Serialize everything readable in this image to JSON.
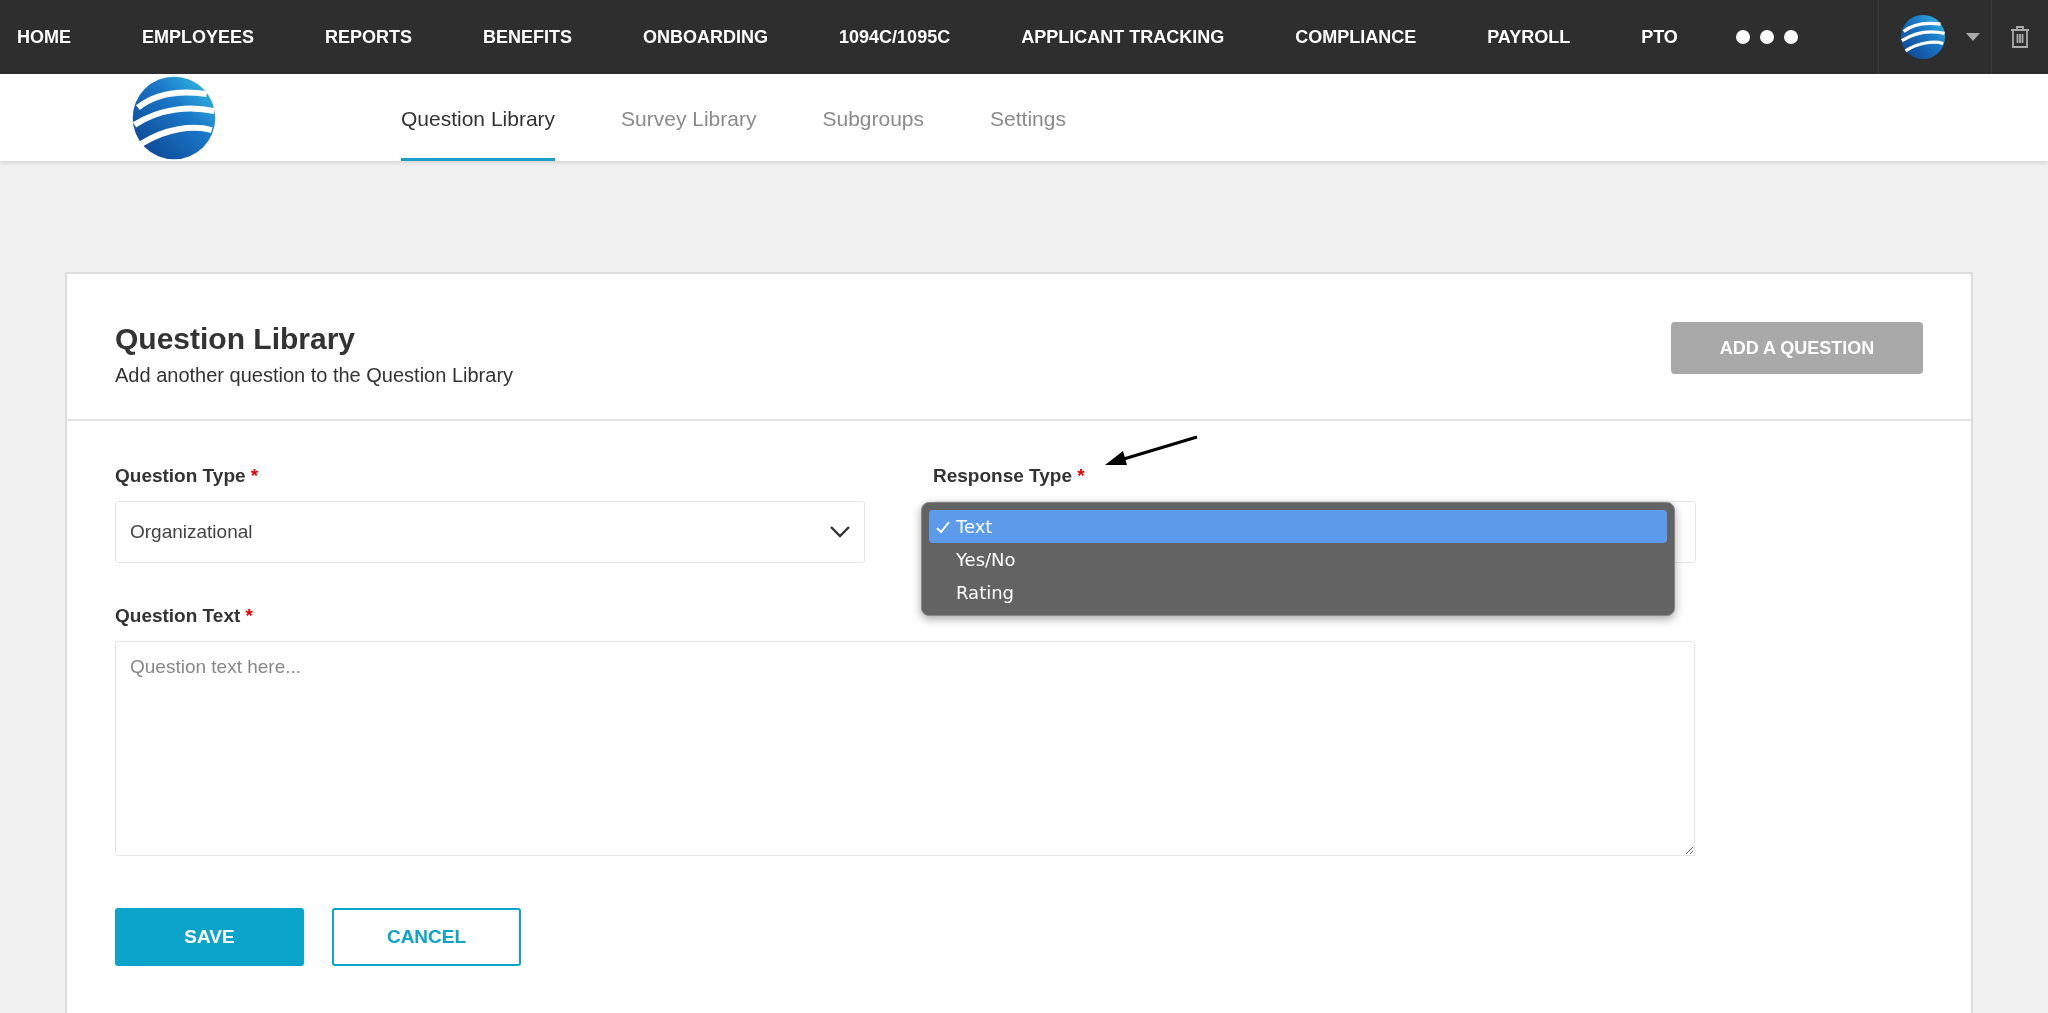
{
  "nav": {
    "items": [
      {
        "label": "HOME"
      },
      {
        "label": "EMPLOYEES"
      },
      {
        "label": "REPORTS"
      },
      {
        "label": "BENEFITS"
      },
      {
        "label": "ONBOARDING"
      },
      {
        "label": "1094C/1095C"
      },
      {
        "label": "APPLICANT TRACKING"
      },
      {
        "label": "COMPLIANCE"
      },
      {
        "label": "PAYROLL"
      },
      {
        "label": "PTO"
      }
    ]
  },
  "tabs": [
    {
      "label": "Question Library",
      "selected": true
    },
    {
      "label": "Survey Library",
      "selected": false
    },
    {
      "label": "Subgroups",
      "selected": false
    },
    {
      "label": "Settings",
      "selected": false
    }
  ],
  "card": {
    "title": "Question Library",
    "subtitle": "Add another question to the Question Library",
    "add_button": "ADD A QUESTION"
  },
  "form": {
    "question_type": {
      "label": "Question Type",
      "required_mark": "*",
      "value": "Organizational"
    },
    "response_type": {
      "label": "Response Type",
      "required_mark": "*",
      "expanded": true,
      "options": [
        {
          "label": "Text",
          "selected": true
        },
        {
          "label": "Yes/No",
          "selected": false
        },
        {
          "label": "Rating",
          "selected": false
        }
      ]
    },
    "question_text": {
      "label": "Question Text",
      "required_mark": "*",
      "placeholder": "Question text here..."
    },
    "buttons": [
      {
        "label": "SAVE",
        "kind": "primary"
      },
      {
        "label": "CANCEL",
        "kind": "secondary"
      }
    ]
  }
}
